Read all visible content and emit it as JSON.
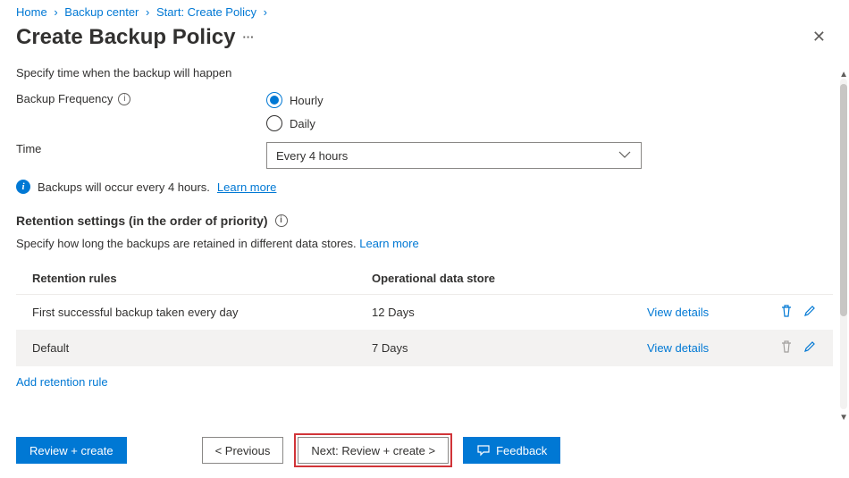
{
  "breadcrumb": {
    "items": [
      "Home",
      "Backup center",
      "Start: Create Policy"
    ]
  },
  "header": {
    "title": "Create Backup Policy"
  },
  "form": {
    "intro": "Specify time when the backup will happen",
    "frequency_label": "Backup Frequency",
    "frequency_options": {
      "hourly": "Hourly",
      "daily": "Daily"
    },
    "time_label": "Time",
    "time_value": "Every 4 hours",
    "info_text": "Backups will occur every 4 hours.",
    "learn_more": "Learn more"
  },
  "retention": {
    "title": "Retention settings (in the order of priority)",
    "subtitle": "Specify how long the backups are retained in different data stores.",
    "learn_more": "Learn more",
    "col1": "Retention rules",
    "col2": "Operational data store",
    "view_details": "View details",
    "add_rule": "Add retention rule",
    "rows": [
      {
        "rule": "First successful backup taken every day",
        "store": "12 Days"
      },
      {
        "rule": "Default",
        "store": "7 Days"
      }
    ]
  },
  "footer": {
    "review_create": "Review + create",
    "previous": "< Previous",
    "next": "Next: Review + create >",
    "feedback": "Feedback"
  }
}
